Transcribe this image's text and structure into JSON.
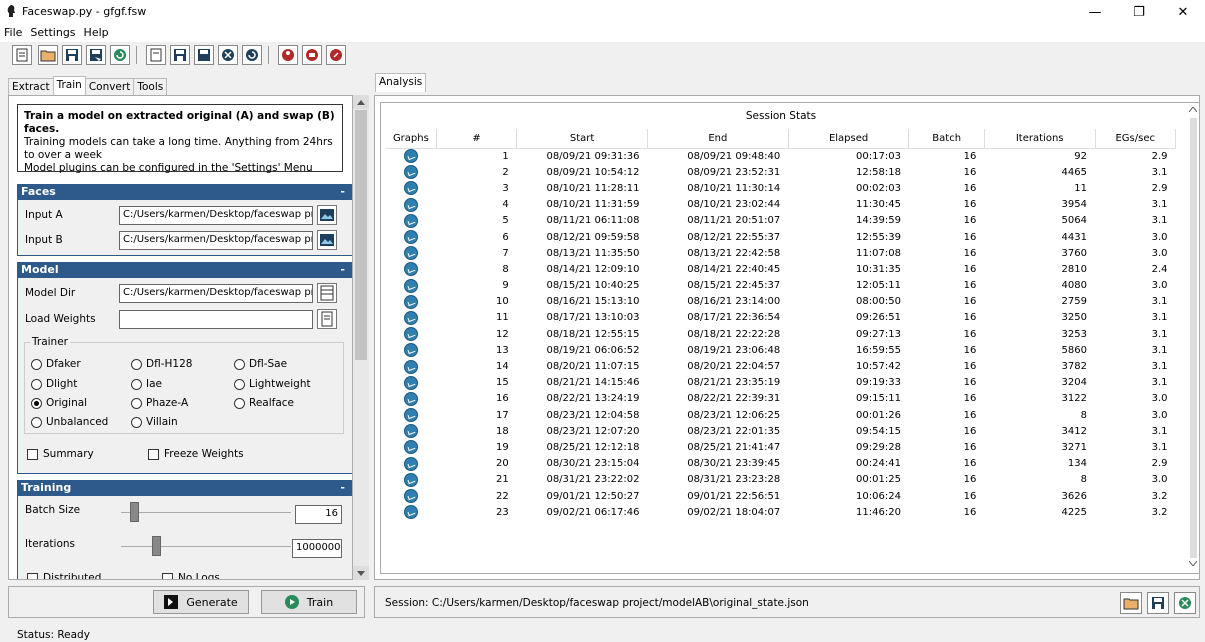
{
  "window": {
    "title": "Faceswap.py - gfgf.fsw",
    "minimize": "—",
    "restore": "❐",
    "close": "✕"
  },
  "menu": [
    "File",
    "Settings",
    "Help"
  ],
  "left_tabs": [
    "Extract",
    "Train",
    "Convert",
    "Tools"
  ],
  "right_tabs": [
    "Analysis"
  ],
  "info": {
    "title": "Train a model on extracted original (A) and swap (B) faces.",
    "line1": "Training models can take a long time. Anything from 24hrs to over a week",
    "line2": "Model plugins can be configured in the 'Settings' Menu"
  },
  "faces": {
    "header": "Faces",
    "input_a_label": "Input A",
    "input_a_value": "C:/Users/karmen/Desktop/faceswap proj",
    "input_b_label": "Input B",
    "input_b_value": "C:/Users/karmen/Desktop/faceswap proj"
  },
  "model": {
    "header": "Model",
    "model_dir_label": "Model Dir",
    "model_dir_value": "C:/Users/karmen/Desktop/faceswap proj",
    "load_weights_label": "Load Weights",
    "load_weights_value": "",
    "trainer_label": "Trainer",
    "trainers": [
      "Dfaker",
      "Dfl-H128",
      "Dfl-Sae",
      "Dlight",
      "Iae",
      "Lightweight",
      "Original",
      "Phaze-A",
      "Realface",
      "Unbalanced",
      "Villain"
    ],
    "selected_trainer": "Original",
    "summary_label": "Summary",
    "freeze_label": "Freeze Weights"
  },
  "training": {
    "header": "Training",
    "batch_label": "Batch Size",
    "batch_value": "16",
    "iter_label": "Iterations",
    "iter_value": "1000000",
    "distributed_label": "Distributed",
    "nologs_label": "No Logs"
  },
  "buttons": {
    "generate": "Generate",
    "train": "Train"
  },
  "stats": {
    "title": "Session Stats",
    "columns": [
      "Graphs",
      "#",
      "Start",
      "End",
      "Elapsed",
      "Batch",
      "Iterations",
      "EGs/sec"
    ],
    "rows": [
      [
        "1",
        "08/09/21 09:31:36",
        "08/09/21 09:48:40",
        "00:17:03",
        "16",
        "92",
        "2.9"
      ],
      [
        "2",
        "08/09/21 10:54:12",
        "08/09/21 23:52:31",
        "12:58:18",
        "16",
        "4465",
        "3.1"
      ],
      [
        "3",
        "08/10/21 11:28:11",
        "08/10/21 11:30:14",
        "00:02:03",
        "16",
        "11",
        "2.9"
      ],
      [
        "4",
        "08/10/21 11:31:59",
        "08/10/21 23:02:44",
        "11:30:45",
        "16",
        "3954",
        "3.1"
      ],
      [
        "5",
        "08/11/21 06:11:08",
        "08/11/21 20:51:07",
        "14:39:59",
        "16",
        "5064",
        "3.1"
      ],
      [
        "6",
        "08/12/21 09:59:58",
        "08/12/21 22:55:37",
        "12:55:39",
        "16",
        "4431",
        "3.0"
      ],
      [
        "7",
        "08/13/21 11:35:50",
        "08/13/21 22:42:58",
        "11:07:08",
        "16",
        "3760",
        "3.0"
      ],
      [
        "8",
        "08/14/21 12:09:10",
        "08/14/21 22:40:45",
        "10:31:35",
        "16",
        "2810",
        "2.4"
      ],
      [
        "9",
        "08/15/21 10:40:25",
        "08/15/21 22:45:37",
        "12:05:11",
        "16",
        "4080",
        "3.0"
      ],
      [
        "10",
        "08/16/21 15:13:10",
        "08/16/21 23:14:00",
        "08:00:50",
        "16",
        "2759",
        "3.1"
      ],
      [
        "11",
        "08/17/21 13:10:03",
        "08/17/21 22:36:54",
        "09:26:51",
        "16",
        "3250",
        "3.1"
      ],
      [
        "12",
        "08/18/21 12:55:15",
        "08/18/21 22:22:28",
        "09:27:13",
        "16",
        "3253",
        "3.1"
      ],
      [
        "13",
        "08/19/21 06:06:52",
        "08/19/21 23:06:48",
        "16:59:55",
        "16",
        "5860",
        "3.1"
      ],
      [
        "14",
        "08/20/21 11:07:15",
        "08/20/21 22:04:57",
        "10:57:42",
        "16",
        "3782",
        "3.1"
      ],
      [
        "15",
        "08/21/21 14:15:46",
        "08/21/21 23:35:19",
        "09:19:33",
        "16",
        "3204",
        "3.1"
      ],
      [
        "16",
        "08/22/21 13:24:19",
        "08/22/21 22:39:31",
        "09:15:11",
        "16",
        "3122",
        "3.0"
      ],
      [
        "17",
        "08/23/21 12:04:58",
        "08/23/21 12:06:25",
        "00:01:26",
        "16",
        "8",
        "3.0"
      ],
      [
        "18",
        "08/23/21 12:07:20",
        "08/23/21 22:01:35",
        "09:54:15",
        "16",
        "3412",
        "3.1"
      ],
      [
        "19",
        "08/25/21 12:12:18",
        "08/25/21 21:41:47",
        "09:29:28",
        "16",
        "3271",
        "3.1"
      ],
      [
        "20",
        "08/30/21 23:15:04",
        "08/30/21 23:39:45",
        "00:24:41",
        "16",
        "134",
        "2.9"
      ],
      [
        "21",
        "08/31/21 23:22:02",
        "08/31/21 23:23:28",
        "00:01:25",
        "16",
        "8",
        "3.0"
      ],
      [
        "22",
        "09/01/21 12:50:27",
        "09/01/21 22:56:51",
        "10:06:24",
        "16",
        "3626",
        "3.2"
      ],
      [
        "23",
        "09/02/21 06:17:46",
        "09/02/21 18:04:07",
        "11:46:20",
        "16",
        "4225",
        "3.2"
      ]
    ]
  },
  "session_path": "Session: C:/Users/karmen/Desktop/faceswap project/modelAB\\original_state.json",
  "status": "Status: Ready"
}
